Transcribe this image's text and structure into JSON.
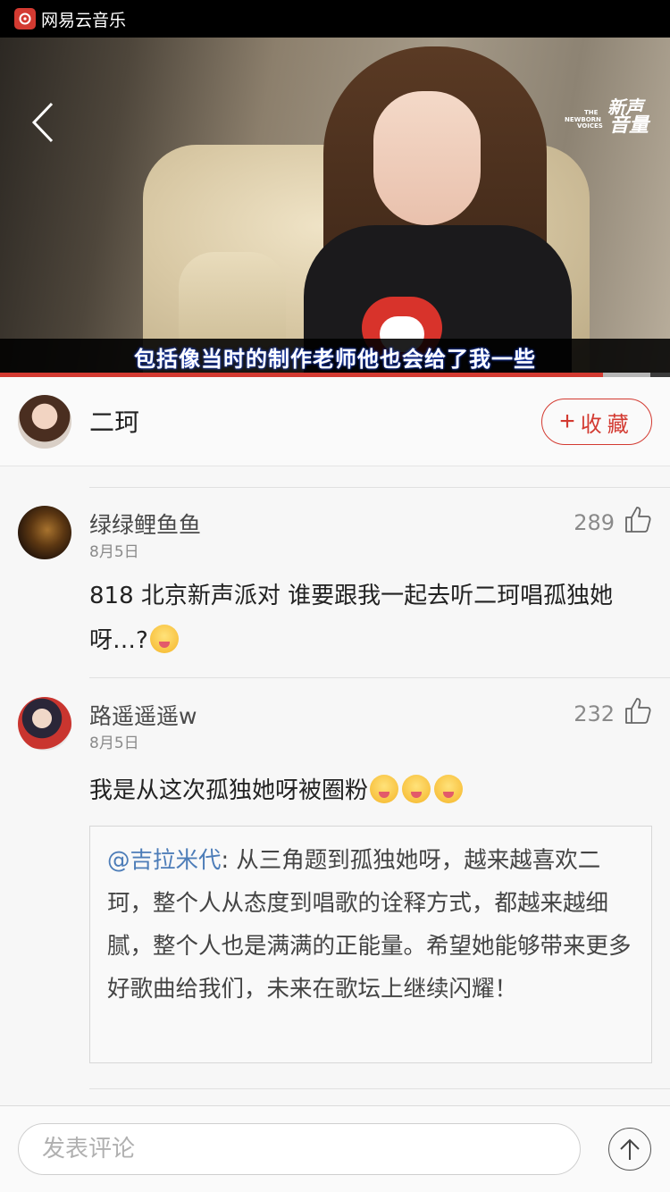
{
  "status_bar": {
    "app_name": "网易云音乐"
  },
  "video": {
    "subtitle": "包括像当时的制作老师他也会给了我一些",
    "watermark_main": "新声",
    "watermark_sub": "音量",
    "watermark_en1": "THE",
    "watermark_en2": "NEWBORN",
    "watermark_en3": "VOICES",
    "progress": 0.9,
    "buffered": 0.97
  },
  "artist": {
    "name": "二珂",
    "collect_label": "收藏",
    "collect_icon": "plus-icon"
  },
  "comments": [
    {
      "user": "绿绿鲤鱼鱼",
      "date": "8月5日",
      "likes": "289",
      "text": "818 北京新声派对 谁要跟我一起去听二珂唱孤独她呀…?",
      "emojis": [
        "smiling-blush-emoji"
      ]
    },
    {
      "user": "路遥遥遥w",
      "date": "8月5日",
      "likes": "232",
      "text": "我是从这次孤独她呀被圈粉",
      "emojis": [
        "tongue-emoji",
        "tongue-emoji",
        "tongue-emoji"
      ],
      "reply": {
        "user": "@吉拉米代",
        "text": ": 从三角题到孤独她呀，越来越喜欢二珂，整个人从态度到唱歌的诠释方式，都越来越细腻，整个人也是满满的正能量。希望她能够带来更多好歌曲给我们，未来在歌坛上继续闪耀！"
      }
    }
  ],
  "bottom": {
    "placeholder": "发表评论",
    "send_icon": "arrow-up-icon"
  },
  "colors": {
    "accent": "#d33a31",
    "link": "#4d7db8"
  }
}
